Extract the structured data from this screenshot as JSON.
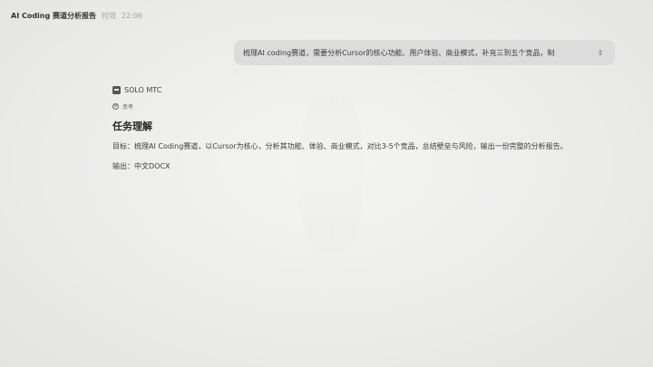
{
  "header": {
    "title": "AI Coding 赛道分析报告",
    "meta_label": "时效",
    "time": "22:06"
  },
  "user_message": {
    "text": "梳理AI coding赛道，需要分析Cursor的核心功能、用户体验、商业模式，补充三到五个竞品，制",
    "expand_icon": "chevron-up-down-icon"
  },
  "assistant": {
    "agent_name": "SOLO MTC",
    "think_label": "思考",
    "section_title": "任务理解",
    "goal_line": "目标：梳理AI Coding赛道，以Cursor为核心，分析其功能、体验、商业模式，对比3-5个竞品，总结壁垒与风险，输出一份完整的分析报告。",
    "output_line": "输出：中文DOCX"
  }
}
